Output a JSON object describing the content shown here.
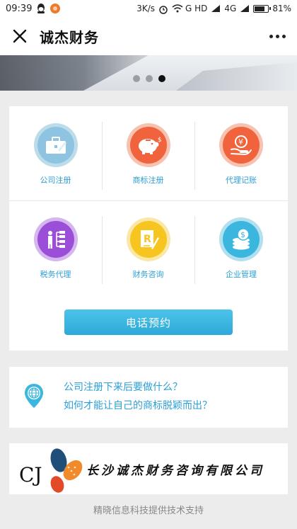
{
  "status_bar": {
    "time": "09:39",
    "speed": "3K/s",
    "network": "G HD",
    "signal": "4G",
    "battery": "81%",
    "battery_level": 0.81
  },
  "title_bar": {
    "title": "诚杰财务"
  },
  "banner": {
    "dots": 3,
    "active_dot": 3
  },
  "services": [
    {
      "label": "公司注册",
      "icon": "briefcase-icon",
      "ring": "#bcdcea",
      "fill": "#8ec4e2"
    },
    {
      "label": "商标注册",
      "icon": "piggy-bank-icon",
      "ring": "#f7c2b0",
      "fill": "#f0633c"
    },
    {
      "label": "代理记账",
      "icon": "coin-hand-icon",
      "ring": "#f7c2b0",
      "fill": "#f0633c"
    },
    {
      "label": "税务代理",
      "icon": "org-chart-icon",
      "ring": "#d6b6ee",
      "fill": "#9b4ed8"
    },
    {
      "label": "财务咨询",
      "icon": "document-pen-icon",
      "ring": "#fbe7a6",
      "fill": "#f6c520"
    },
    {
      "label": "企业管理",
      "icon": "coin-stack-icon",
      "ring": "#b2e0ee",
      "fill": "#3bb6de"
    }
  ],
  "phone_button": {
    "label": "电话预约"
  },
  "faq": {
    "question_1": "公司注册下来后要做什么？",
    "question_2": "如何才能让自己的商标脱颖而出？"
  },
  "company": {
    "logo_text": "CJ",
    "name": "长沙诚杰财务咨询有限公司"
  },
  "footer": {
    "text": "精晓信息科技提供技术支持"
  }
}
